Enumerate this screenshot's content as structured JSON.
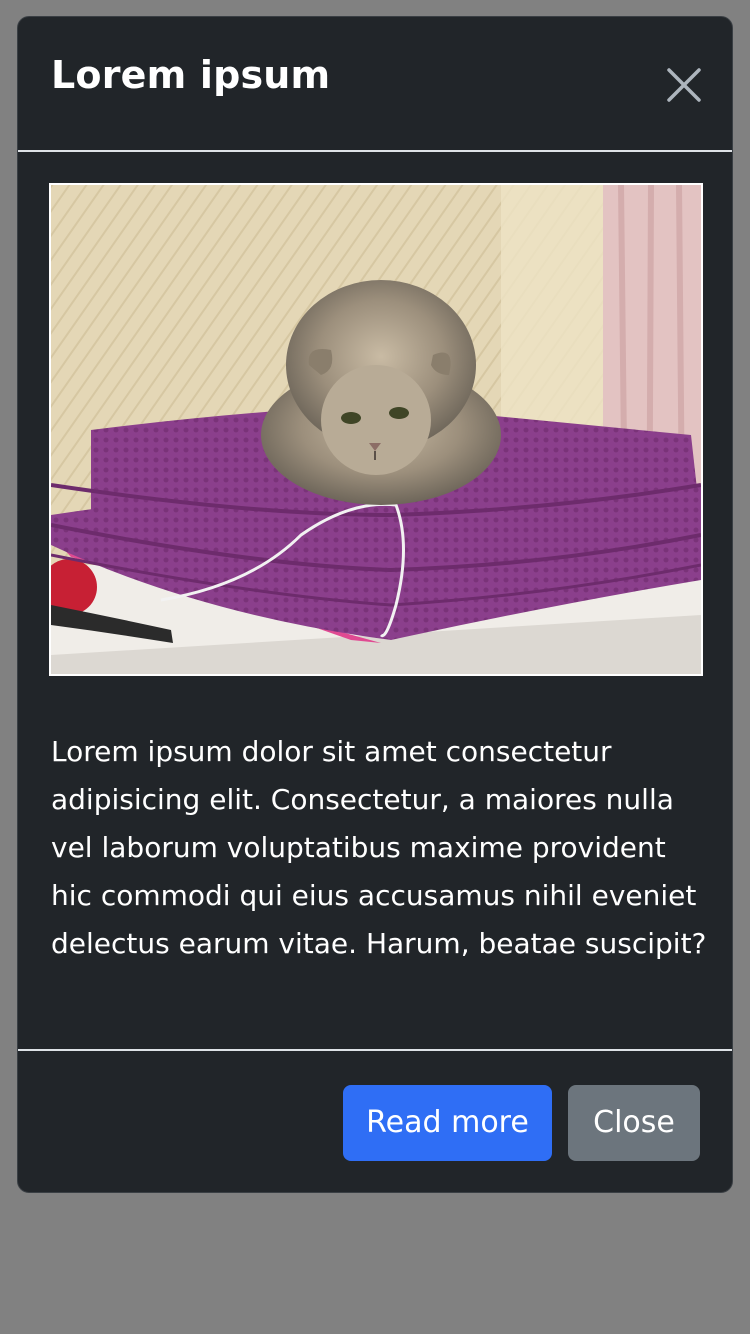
{
  "modal": {
    "title": "Lorem ipsum",
    "close_icon": "close-icon",
    "image_alt_icon": "cat-photo",
    "body_text": "Lorem ipsum dolor sit amet consectetur adipisicing elit. Consectetur, a maiores nulla vel laborum voluptatibus maxime provident hic commodi qui eius accusamus nihil eveniet delectus earum vitae. Harum, beatae suscipit?",
    "buttons": {
      "primary_label": "Read more",
      "secondary_label": "Close"
    }
  },
  "colors": {
    "backdrop": "#818181",
    "modal_bg": "#212529",
    "primary": "#2f6ef5",
    "secondary": "#6c757d",
    "divider": "#dee2e6"
  }
}
